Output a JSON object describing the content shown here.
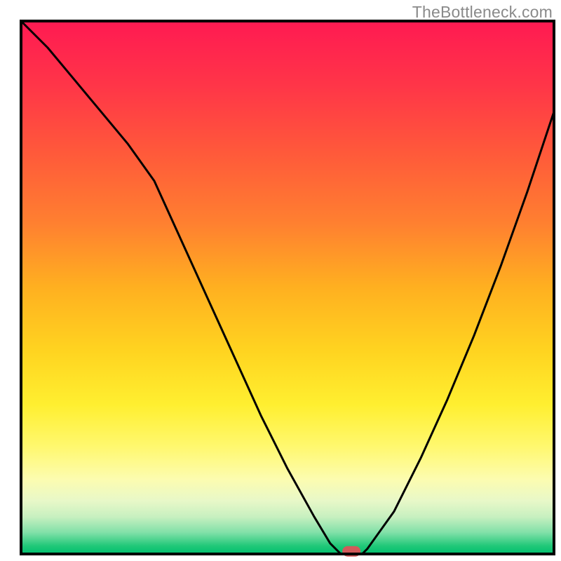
{
  "watermark": "TheBottleneck.com",
  "chart_data": {
    "type": "line",
    "title": "",
    "xlabel": "",
    "ylabel": "",
    "xlim": [
      0,
      100
    ],
    "ylim": [
      0,
      100
    ],
    "x": [
      0,
      5,
      10,
      15,
      20,
      25,
      30,
      35,
      40,
      45,
      50,
      55,
      58,
      60,
      62,
      64,
      65,
      70,
      75,
      80,
      85,
      90,
      95,
      100
    ],
    "values": [
      100,
      95,
      89,
      83,
      77,
      70,
      59,
      48,
      37,
      26,
      16,
      7,
      2,
      0,
      0,
      0,
      1,
      8,
      18,
      29,
      41,
      54,
      68,
      83
    ],
    "marker": {
      "x": 62,
      "y": 0.5,
      "color": "#d15a5a"
    },
    "gradient_stops": [
      {
        "offset": 0.0,
        "color": "#ff1a52"
      },
      {
        "offset": 0.12,
        "color": "#ff3548"
      },
      {
        "offset": 0.25,
        "color": "#ff5a3a"
      },
      {
        "offset": 0.38,
        "color": "#ff8030"
      },
      {
        "offset": 0.5,
        "color": "#ffb020"
      },
      {
        "offset": 0.62,
        "color": "#ffd420"
      },
      {
        "offset": 0.72,
        "color": "#ffef30"
      },
      {
        "offset": 0.8,
        "color": "#fff870"
      },
      {
        "offset": 0.86,
        "color": "#fcfcb0"
      },
      {
        "offset": 0.9,
        "color": "#e8f8c8"
      },
      {
        "offset": 0.93,
        "color": "#c8f0c0"
      },
      {
        "offset": 0.96,
        "color": "#80e0a8"
      },
      {
        "offset": 0.985,
        "color": "#20c878"
      },
      {
        "offset": 1.0,
        "color": "#00bf6f"
      }
    ],
    "border_color": "#000000",
    "line_color": "#000000"
  }
}
